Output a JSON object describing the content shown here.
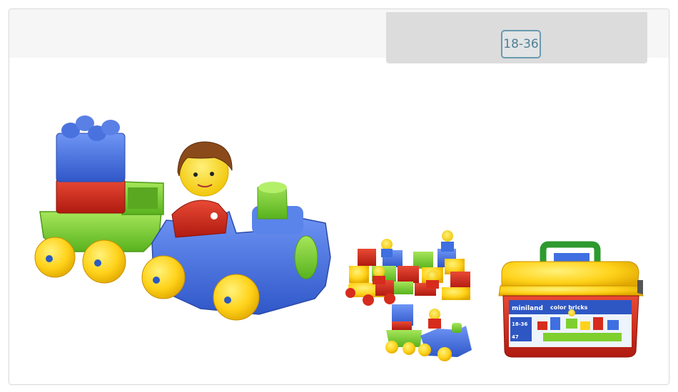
{
  "age_badge": {
    "label": "18-36"
  },
  "product_box": {
    "brand": "miniland",
    "title": "color bricks",
    "age": "18-36",
    "count": "47"
  },
  "colors": {
    "blue": "#3f6fe0",
    "red": "#d72b1d",
    "green": "#7fcf2f",
    "yellow": "#ffd21a",
    "badge_border": "#6a9ab0"
  }
}
